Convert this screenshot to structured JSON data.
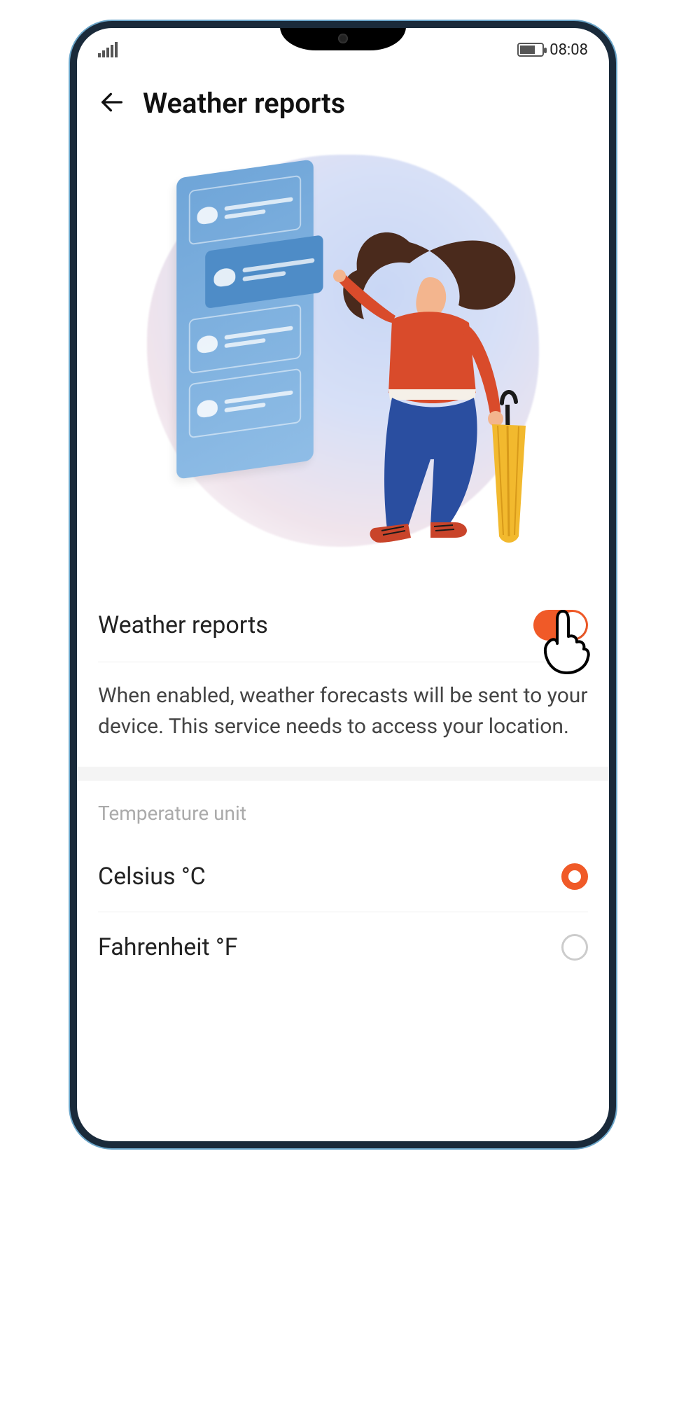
{
  "status": {
    "time": "08:08"
  },
  "header": {
    "title": "Weather reports"
  },
  "settings": {
    "toggle_label": "Weather reports",
    "toggle_on": true,
    "description": "When enabled, weather forecasts will be sent to your device. This service needs to access your location."
  },
  "temperature_unit": {
    "section_title": "Temperature unit",
    "options": [
      {
        "label": "Celsius °C",
        "selected": true
      },
      {
        "label": "Fahrenheit °F",
        "selected": false
      }
    ]
  }
}
